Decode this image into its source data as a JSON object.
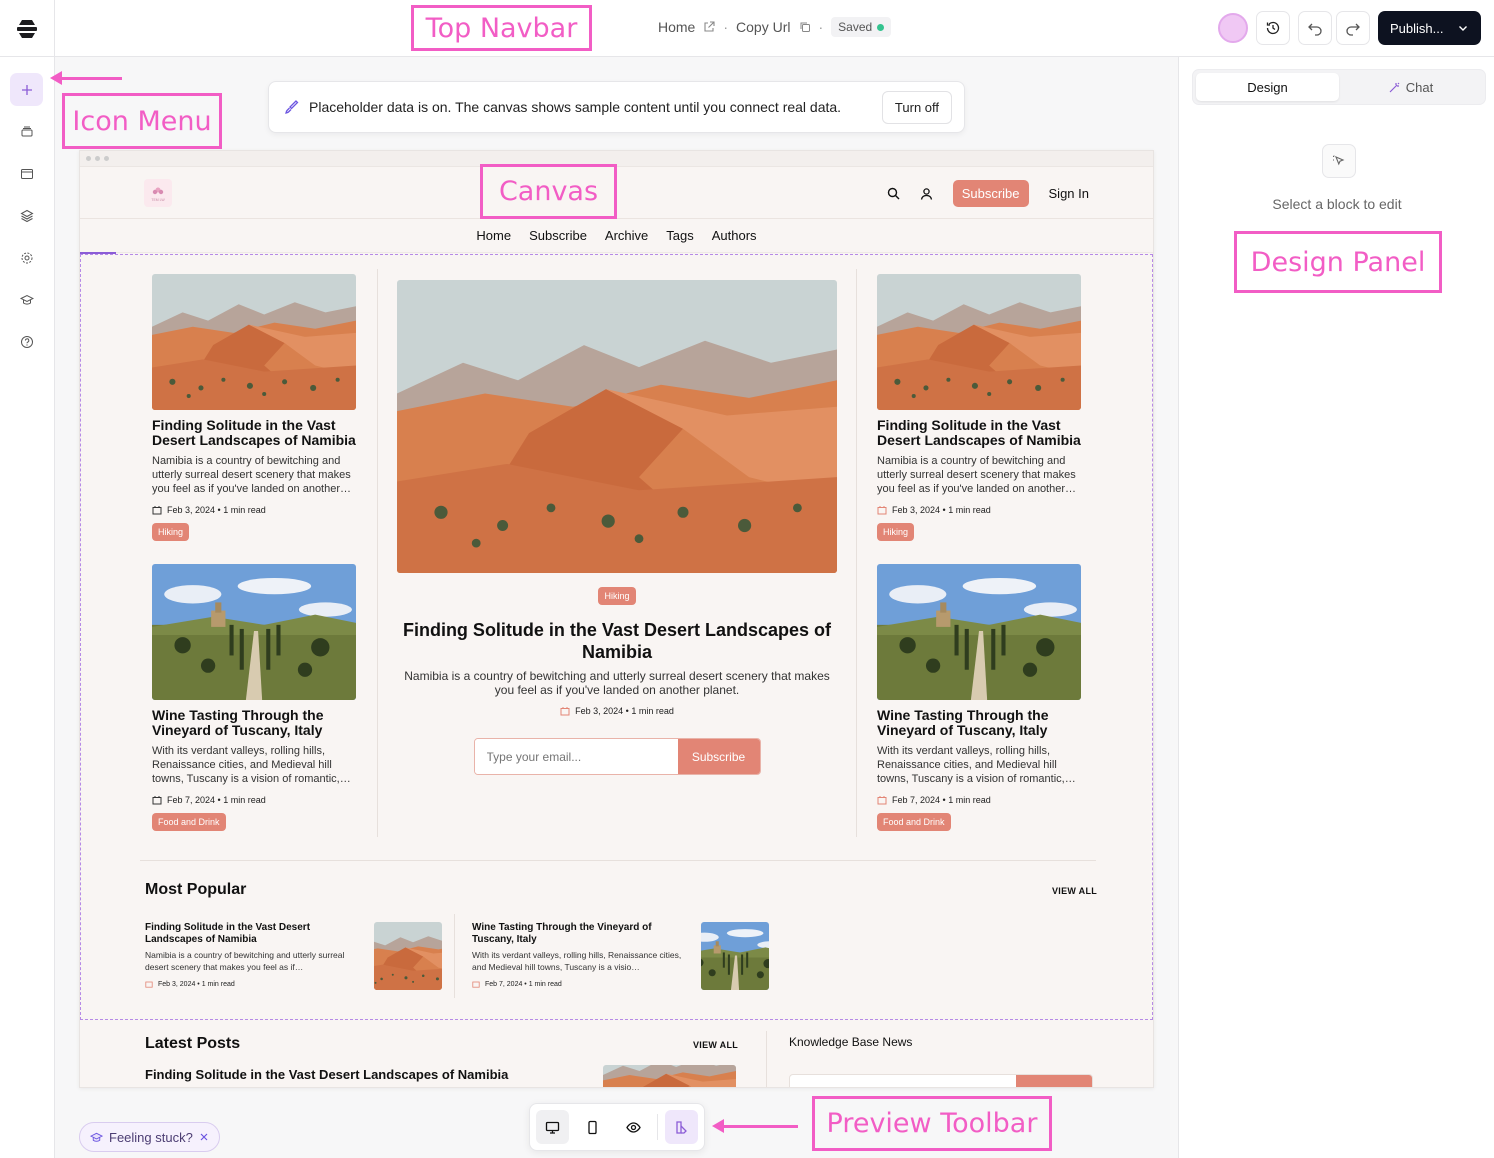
{
  "topbar": {
    "home_label": "Home",
    "copy_url_label": "Copy Url",
    "saved_label": "Saved",
    "publish_label": "Publish...",
    "colors": {
      "accent": "#0d1220",
      "saved_dot": "#34c38f"
    }
  },
  "icon_menu": {
    "items": [
      "add-icon",
      "stack-icon",
      "browser-window-icon",
      "layers-icon",
      "settings-icon",
      "graduation-cap-icon",
      "help-icon"
    ]
  },
  "design_panel": {
    "tabs": [
      {
        "label": "Design"
      },
      {
        "label": "Chat"
      }
    ],
    "empty_state": "Select a block to edit"
  },
  "banner": {
    "message": "Placeholder data is on. The canvas shows sample content until you connect real data.",
    "button": "Turn off"
  },
  "site": {
    "logo_text": "TEM LW",
    "header_subscribe": "Subscribe",
    "sign_in": "Sign In",
    "nav": [
      "Home",
      "Subscribe",
      "Archive",
      "Tags",
      "Authors"
    ],
    "brand_color": "#e28575",
    "cards": [
      {
        "title": "Finding Solitude in the Vast Desert Landscapes of Namibia",
        "excerpt": "Namibia is a country of bewitching and utterly surreal desert scenery that makes you feel as if you've landed on another…",
        "meta": "Feb 3, 2024 • 1 min read",
        "tag": "Hiking"
      },
      {
        "title": "Wine Tasting Through the Vineyard of Tuscany, Italy",
        "excerpt": "With its verdant valleys, rolling hills, Renaissance cities, and Medieval hill towns, Tuscany is a vision of romantic,…",
        "meta": "Feb 7, 2024 • 1 min read",
        "tag": "Food and Drink"
      }
    ],
    "feature": {
      "tag": "Hiking",
      "title": "Finding Solitude in the Vast Desert Landscapes of Namibia",
      "excerpt": "Namibia is a country of bewitching and utterly surreal desert scenery that makes you feel as if you've landed on another planet.",
      "meta": "Feb 3, 2024 • 1 min read",
      "email_placeholder": "Type your email...",
      "subscribe_button": "Subscribe"
    },
    "most_popular": {
      "title": "Most Popular",
      "view_all": "VIEW ALL",
      "items": [
        {
          "title": "Finding Solitude in the Vast Desert Landscapes of Namibia",
          "excerpt": "Namibia is a country of bewitching and utterly surreal desert scenery that makes you feel as if…",
          "meta": "Feb 3, 2024 • 1 min read"
        },
        {
          "title": "Wine Tasting Through the Vineyard of Tuscany, Italy",
          "excerpt": "With its verdant valleys, rolling hills, Renaissance cities, and Medieval hill towns, Tuscany is a visio…",
          "meta": "Feb 7, 2024 • 1 min read"
        }
      ]
    },
    "latest_posts": {
      "title": "Latest Posts",
      "view_all": "VIEW ALL",
      "first_title": "Finding Solitude in the Vast Desert Landscapes of Namibia"
    },
    "knowledge_base": "Knowledge Base News"
  },
  "bottom": {
    "feeling_stuck": "Feeling stuck?",
    "preview_tools": [
      "desktop-icon",
      "mobile-icon",
      "eye-icon",
      "ai-layout-icon"
    ]
  },
  "annotations": {
    "top_navbar": "Top Navbar",
    "icon_menu": "Icon Menu",
    "canvas": "Canvas",
    "design_panel": "Design Panel",
    "preview_toolbar": "Preview Toolbar",
    "color": "#f25dc5"
  }
}
